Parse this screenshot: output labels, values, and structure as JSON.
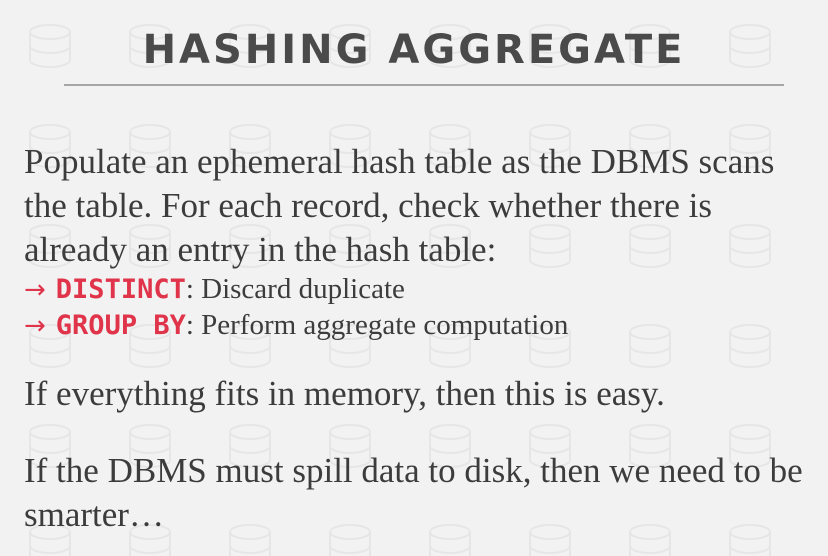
{
  "slide": {
    "title": "HASHING AGGREGATE",
    "paragraph1": "Populate an ephemeral hash table as the DBMS scans the table. For each record, check whether there is already an entry in the hash table:",
    "bullets": [
      {
        "arrow": "→",
        "keyword": "DISTINCT",
        "text": ": Discard duplicate"
      },
      {
        "arrow": "→",
        "keyword": "GROUP BY",
        "text": ": Perform aggregate computation"
      }
    ],
    "paragraph2": "If everything fits in memory, then this is easy.",
    "paragraph3": "If the DBMS must spill data to disk, then we need to be smarter…"
  },
  "colors": {
    "background": "#f2f2f2",
    "accent_red": "#e0344b",
    "title_text": "#4a4a4a",
    "body_text": "#3c3c3c",
    "rule": "#a6a6a6"
  }
}
